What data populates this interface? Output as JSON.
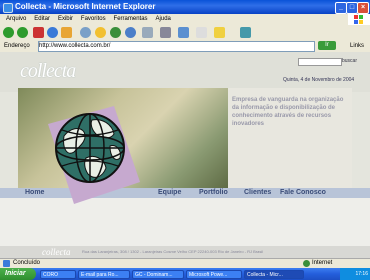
{
  "window": {
    "title": "Collecta - Microsoft Internet Explorer"
  },
  "menu": [
    "Arquivo",
    "Editar",
    "Exibir",
    "Favoritos",
    "Ferramentas",
    "Ajuda"
  ],
  "address": {
    "label": "Endereço",
    "url": "http://www.collecta.com.br/",
    "go": "Ir",
    "links": "Links"
  },
  "page": {
    "logo": "collecta",
    "search": "buscar",
    "date": "Quinta, 4 de Novembro de 2004",
    "tagline": "Empresa de vanguarda na organização da informação e disponibilização de conhecimento através de recursos inovadores",
    "nav": [
      "Home",
      "Equipe",
      "Portfolio",
      "Clientes",
      "Fale Conosco"
    ],
    "footer_logo": "collecta",
    "footer_text": "Rua das Laranjeiras, 308 / 1302 - Laranjeiras Cosme Velho CEP 22240-003 Rio de Janeiro - RJ Brasil"
  },
  "status": {
    "text": "Concluído",
    "zone": "Internet"
  },
  "taskbar": {
    "start": "Iniciar",
    "tasks": [
      "CORO",
      "E-mail para Ro...",
      "GC - Dominam...",
      "Microsoft Powe...",
      "Collecta - Micr..."
    ],
    "clock": "17:16"
  }
}
